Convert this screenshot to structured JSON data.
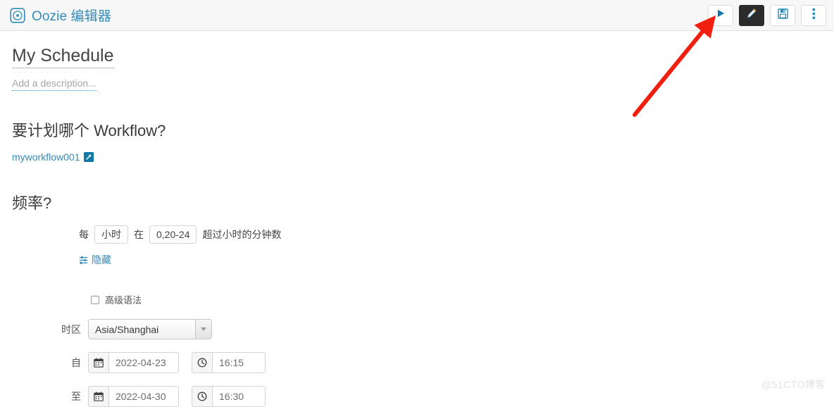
{
  "header": {
    "logo_icon": "oozie-circle-icon",
    "title": "Oozie 编辑器",
    "toolbar": [
      {
        "name": "run",
        "icon": "play-icon",
        "active": false
      },
      {
        "name": "edit",
        "icon": "pencil-icon",
        "active": true
      },
      {
        "name": "save",
        "icon": "floppy-save-icon",
        "active": false
      },
      {
        "name": "more",
        "icon": "three-dots-vertical-icon",
        "active": false
      }
    ]
  },
  "schedule": {
    "title": "My Schedule",
    "description_placeholder": "Add a description..."
  },
  "workflow_section": {
    "heading": "要计划哪个 Workflow?",
    "link_label": "myworkflow001",
    "link_icon": "external-link-icon"
  },
  "frequency_section": {
    "heading": "频率?",
    "every_label": "每",
    "unit_value": "小时",
    "at_label": "在",
    "minutes_value": "0,20-24",
    "suffix_label": "超过小时的分钟数",
    "toggle_icon": "sliders-icon",
    "toggle_label": "隐藏",
    "advanced_checkbox_label": "高级语法",
    "advanced_checkbox_checked": false,
    "timezone_label": "时区",
    "timezone_value": "Asia/Shanghai",
    "from_label": "自",
    "from_date": "2022-04-23",
    "from_time": "16:15",
    "to_label": "至",
    "to_date": "2022-04-30",
    "to_time": "16:30",
    "calendar_icon": "calendar-icon",
    "clock_icon": "clock-icon"
  },
  "annotation": {
    "arrow_color": "#f01f10",
    "points_to": "run-button"
  },
  "watermark": {
    "text": "@51CTO博客"
  },
  "colors": {
    "brand_blue": "#338bb8",
    "link_blue": "#338bb8",
    "active_button_bg": "#2b2b2b",
    "header_bg": "#f7f7f7"
  }
}
